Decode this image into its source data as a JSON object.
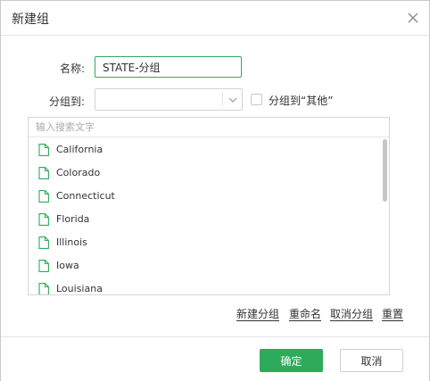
{
  "dialog": {
    "title": "新建组"
  },
  "form": {
    "name_label": "名称:",
    "name_value": "STATE-分组",
    "group_to_label": "分组到:",
    "group_to_value": "",
    "other_checkbox_label": "分组到“其他”",
    "other_checked": false
  },
  "list": {
    "search_placeholder": "输入搜索文字",
    "items": [
      {
        "label": "California"
      },
      {
        "label": "Colorado"
      },
      {
        "label": "Connecticut"
      },
      {
        "label": "Florida"
      },
      {
        "label": "Illinois"
      },
      {
        "label": "Iowa"
      },
      {
        "label": "Louisiana"
      }
    ]
  },
  "actions": {
    "new_group": "新建分组",
    "rename": "重命名",
    "ungroup": "取消分组",
    "reset": "重置"
  },
  "footer": {
    "ok_label": "确定",
    "cancel_label": "取消"
  },
  "colors": {
    "accent": "#2eab5a",
    "icon": "#2eab5a",
    "border": "#d6d6d6"
  },
  "icons": {
    "close": "close-icon",
    "dropdown": "chevron-down-icon",
    "list_item": "file-icon"
  }
}
